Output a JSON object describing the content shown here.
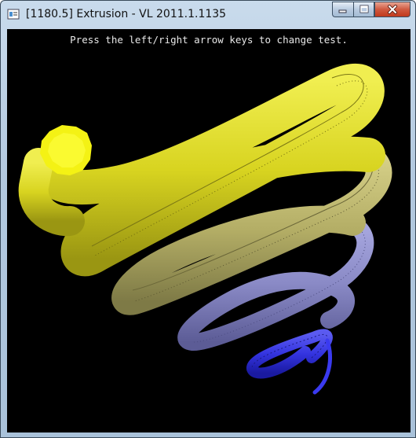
{
  "window": {
    "title": "[1180.5] Extrusion - VL 2011.1.1135",
    "controls": {
      "minimize": "minimize",
      "maximize": "maximize",
      "close": "close"
    }
  },
  "viewport": {
    "instruction_text": "Press the left/right arrow keys to change test.",
    "background": "#000000",
    "colors": {
      "yellow": "#e4e22a",
      "khaki": "#b8b26a",
      "lavender": "#8c8cc8",
      "blue": "#3030e0",
      "cap": "#f2f21a"
    }
  }
}
